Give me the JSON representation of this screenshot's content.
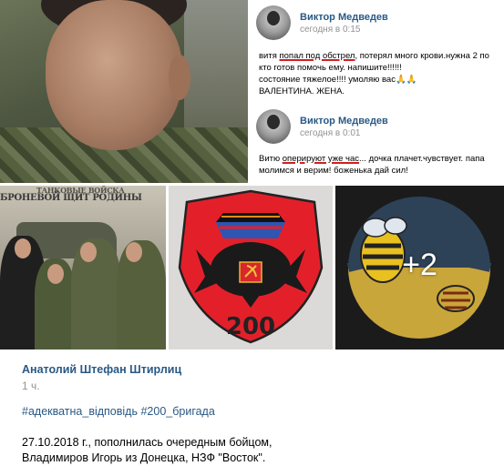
{
  "comments": [
    {
      "author": "Виктор Медведев",
      "time": "сегодня в 0:15",
      "lines": {
        "l1_pre": "витя ",
        "l1_ul": "попал под обстрел",
        "l1_post": ", потерял много крови.нужна 2 по",
        "l2": "кто готов помочь ему. напишите!!!!!!",
        "l3_pre": "состояние тяжелое!!!! умоляю вас",
        "l3_emoji": "🙏🙏",
        "l4": "ВАЛЕНТИНА. ЖЕНА."
      }
    },
    {
      "author": "Виктор Медведев",
      "time": "сегодня в 0:01",
      "lines": {
        "l1_pre": "Витю ",
        "l1_ul": "оперируют уже час",
        "l1_post": "... дочка плачет.чувствует. папа",
        "l2": "молимся и верим! боженька дай сил!"
      }
    }
  ],
  "photos": {
    "group_banner_top": "ТАНКОВЫЕ ВОЙСКА",
    "group_banner": "БРОНЕВОЙ ЩИТ РОДИНЫ",
    "emblem_label": "200",
    "more_count": "+2"
  },
  "post": {
    "author": "Анатолий Штефан Штирлиц",
    "time": "1 ч.",
    "hashtags": [
      "#адекватна_відповідь",
      "#200_бригада"
    ],
    "body_line1": "27.10.2018 г., пополнилась очередным бойцом,",
    "body_line2": "Владимиров Игорь из Донецка, НЗФ \"Восток\"."
  },
  "colors": {
    "link": "#2a5885",
    "muted": "#939393",
    "underline": "#d02020"
  }
}
